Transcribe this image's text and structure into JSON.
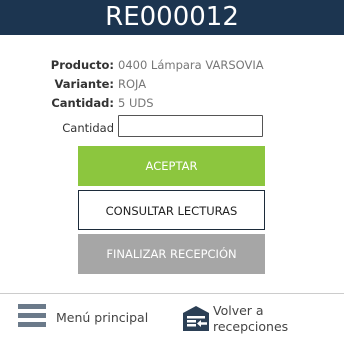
{
  "header": {
    "title": "RE000012"
  },
  "details": {
    "product_label": "Producto:",
    "product_value": "0400 Lámpara VARSOVIA",
    "variant_label": "Variante:",
    "variant_value": "ROJA",
    "quantity_label": "Cantidad:",
    "quantity_value": "5 UDS"
  },
  "form": {
    "quantity_field_label": "Cantidad",
    "quantity_field_value": ""
  },
  "buttons": {
    "accept": "ACEPTAR",
    "consult": "CONSULTAR LECTURAS",
    "finish": "FINALIZAR RECEPCIÓN"
  },
  "footer": {
    "menu_label": "Menú principal",
    "back_label_line1": "Volver a",
    "back_label_line2": "recepciones",
    "menu_icon": "menu-icon",
    "back_icon": "warehouse-return-icon"
  },
  "colors": {
    "header_bg": "#1c3550",
    "accept_bg": "#8cc63e",
    "finish_bg": "#a6a6a6"
  }
}
